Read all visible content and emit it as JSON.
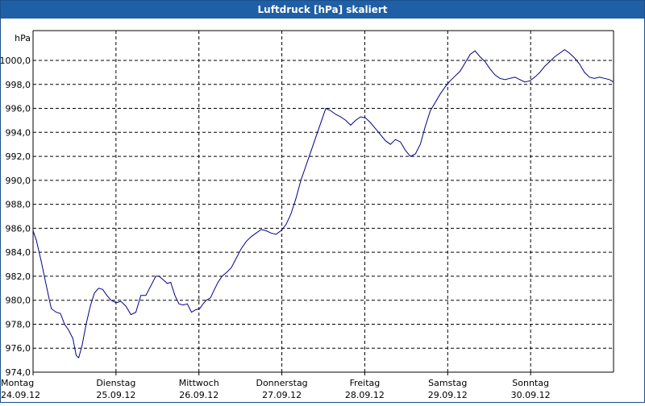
{
  "window": {
    "title": "Luftdruck [hPa] skaliert"
  },
  "chart_data": {
    "type": "line",
    "title": "Luftdruck [hPa] skaliert",
    "ylabel": "hPa",
    "ylim": [
      974,
      1002
    ],
    "xlim": [
      0,
      7
    ],
    "yticks": [
      "974,0",
      "976,0",
      "978,0",
      "980,0",
      "982,0",
      "984,0",
      "986,0",
      "988,0",
      "990,0",
      "992,0",
      "994,0",
      "996,0",
      "998,0",
      "1000,0"
    ],
    "ytick_values": [
      974,
      976,
      978,
      980,
      982,
      984,
      986,
      988,
      990,
      992,
      994,
      996,
      998,
      1000
    ],
    "x_ticks": [
      {
        "day": "Montag",
        "date": "24.09.12"
      },
      {
        "day": "Dienstag",
        "date": "25.09.12"
      },
      {
        "day": "Mittwoch",
        "date": "26.09.12"
      },
      {
        "day": "Donnerstag",
        "date": "27.09.12"
      },
      {
        "day": "Freitag",
        "date": "28.09.12"
      },
      {
        "day": "Samstag",
        "date": "29.09.12"
      },
      {
        "day": "Sonntag",
        "date": "30.09.12"
      }
    ],
    "grid": true,
    "colors": {
      "line": "#00008b",
      "grid": "#000000"
    },
    "series": [
      {
        "name": "",
        "x": [
          0.0,
          0.04,
          0.1,
          0.16,
          0.22,
          0.28,
          0.33,
          0.38,
          0.43,
          0.48,
          0.52,
          0.55,
          0.59,
          0.64,
          0.69,
          0.74,
          0.79,
          0.84,
          0.89,
          0.94,
          1.0,
          1.06,
          1.12,
          1.18,
          1.24,
          1.3,
          1.36,
          1.42,
          1.48,
          1.52,
          1.57,
          1.62,
          1.66,
          1.71,
          1.76,
          1.81,
          1.86,
          1.91,
          1.96,
          2.01,
          2.05,
          2.09,
          2.14,
          2.18,
          2.23,
          2.28,
          2.33,
          2.39,
          2.45,
          2.51,
          2.57,
          2.63,
          2.69,
          2.75,
          2.81,
          2.87,
          2.93,
          2.99,
          3.05,
          3.11,
          3.17,
          3.23,
          3.29,
          3.35,
          3.41,
          3.47,
          3.53,
          3.59,
          3.65,
          3.71,
          3.77,
          3.83,
          3.89,
          3.95,
          4.01,
          4.07,
          4.13,
          4.19,
          4.25,
          4.31,
          4.37,
          4.43,
          4.49,
          4.55,
          4.61,
          4.67,
          4.73,
          4.79,
          4.85,
          4.91,
          4.97,
          5.03,
          5.09,
          5.15,
          5.21,
          5.27,
          5.33,
          5.39,
          5.45,
          5.51,
          5.57,
          5.63,
          5.69,
          5.75,
          5.81,
          5.87,
          5.93,
          5.99,
          6.05,
          6.11,
          6.17,
          6.23,
          6.29,
          6.35,
          6.41,
          6.47,
          6.53,
          6.59,
          6.65,
          6.71,
          6.77,
          6.83,
          6.89,
          6.95,
          7.0
        ],
        "values": [
          985.8,
          985.0,
          983.2,
          981.2,
          979.3,
          979.0,
          978.9,
          978.0,
          977.5,
          976.8,
          975.4,
          975.2,
          976.2,
          978.0,
          979.5,
          980.6,
          981.0,
          980.9,
          980.4,
          980.0,
          979.8,
          979.9,
          979.5,
          978.8,
          979.0,
          980.4,
          980.4,
          981.2,
          982.0,
          982.0,
          981.7,
          981.4,
          981.5,
          980.4,
          979.7,
          979.6,
          979.7,
          979.0,
          979.2,
          979.3,
          979.7,
          980.0,
          980.2,
          980.8,
          981.5,
          982.0,
          982.3,
          982.7,
          983.5,
          984.3,
          984.9,
          985.3,
          985.6,
          985.9,
          985.8,
          985.6,
          985.5,
          985.8,
          986.3,
          987.2,
          988.5,
          990.0,
          991.2,
          992.4,
          993.6,
          994.8,
          996.0,
          995.8,
          995.5,
          995.3,
          995.0,
          994.6,
          995.0,
          995.3,
          995.2,
          994.8,
          994.3,
          993.8,
          993.3,
          993.0,
          993.4,
          993.2,
          992.5,
          992.0,
          992.2,
          993.0,
          994.5,
          995.8,
          996.5,
          997.2,
          997.8,
          998.3,
          998.7,
          999.1,
          999.8,
          1000.5,
          1000.8,
          1000.3,
          999.9,
          999.3,
          998.8,
          998.5,
          998.4,
          998.5,
          998.6,
          998.4,
          998.2,
          998.3,
          998.6,
          999.0,
          999.5,
          999.9,
          1000.3,
          1000.6,
          1000.9,
          1000.6,
          1000.2,
          999.7,
          999.0,
          998.6,
          998.5,
          998.6,
          998.5,
          998.4,
          998.2
        ]
      }
    ]
  }
}
